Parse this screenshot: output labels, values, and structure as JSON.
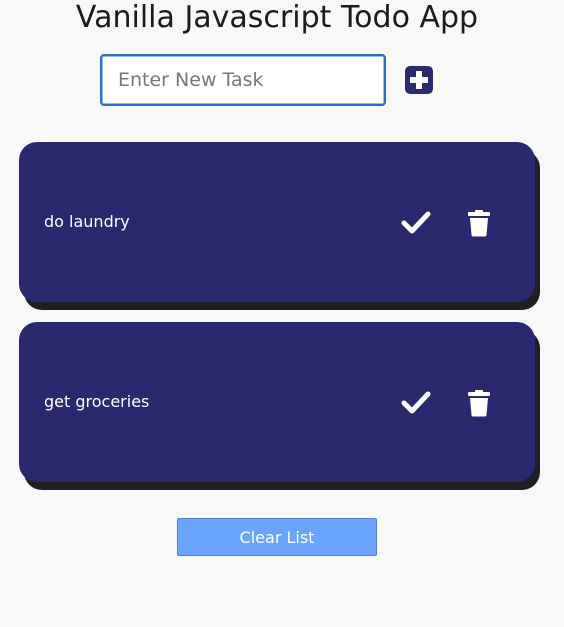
{
  "app": {
    "title": "Vanilla Javascript Todo App"
  },
  "input": {
    "placeholder": "Enter New Task",
    "value": ""
  },
  "add_button": {
    "icon": "plus-square-icon"
  },
  "todos": [
    {
      "text": "do laundry",
      "complete_icon": "check-icon",
      "delete_icon": "trash-icon"
    },
    {
      "text": "get groceries",
      "complete_icon": "check-icon",
      "delete_icon": "trash-icon"
    }
  ],
  "clear_button": {
    "label": "Clear List"
  },
  "colors": {
    "background": "#f8f8f8",
    "card": "#2a286f",
    "card_shadow": "#1e1e24",
    "input_border": "#2f6cc7",
    "add_button": "#2a2a6e",
    "clear_button": "#6aa4ff",
    "icon": "#ffffff"
  }
}
